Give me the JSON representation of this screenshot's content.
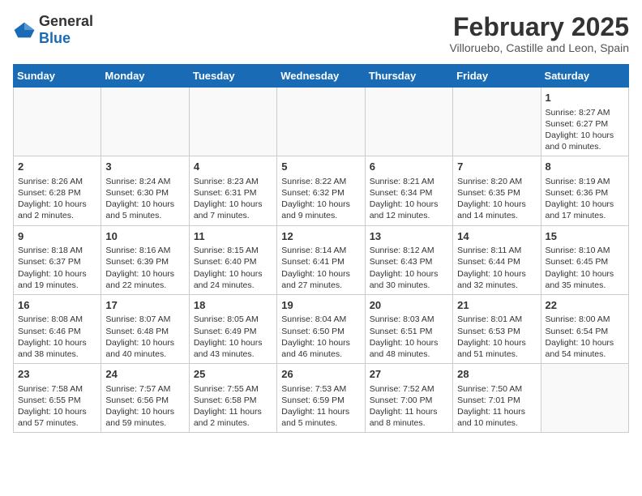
{
  "header": {
    "logo_general": "General",
    "logo_blue": "Blue",
    "title": "February 2025",
    "subtitle": "Villoruebo, Castille and Leon, Spain"
  },
  "days_of_week": [
    "Sunday",
    "Monday",
    "Tuesday",
    "Wednesday",
    "Thursday",
    "Friday",
    "Saturday"
  ],
  "weeks": [
    [
      {
        "day": "",
        "info": ""
      },
      {
        "day": "",
        "info": ""
      },
      {
        "day": "",
        "info": ""
      },
      {
        "day": "",
        "info": ""
      },
      {
        "day": "",
        "info": ""
      },
      {
        "day": "",
        "info": ""
      },
      {
        "day": "1",
        "info": "Sunrise: 8:27 AM\nSunset: 6:27 PM\nDaylight: 10 hours\nand 0 minutes."
      }
    ],
    [
      {
        "day": "2",
        "info": "Sunrise: 8:26 AM\nSunset: 6:28 PM\nDaylight: 10 hours\nand 2 minutes."
      },
      {
        "day": "3",
        "info": "Sunrise: 8:24 AM\nSunset: 6:30 PM\nDaylight: 10 hours\nand 5 minutes."
      },
      {
        "day": "4",
        "info": "Sunrise: 8:23 AM\nSunset: 6:31 PM\nDaylight: 10 hours\nand 7 minutes."
      },
      {
        "day": "5",
        "info": "Sunrise: 8:22 AM\nSunset: 6:32 PM\nDaylight: 10 hours\nand 9 minutes."
      },
      {
        "day": "6",
        "info": "Sunrise: 8:21 AM\nSunset: 6:34 PM\nDaylight: 10 hours\nand 12 minutes."
      },
      {
        "day": "7",
        "info": "Sunrise: 8:20 AM\nSunset: 6:35 PM\nDaylight: 10 hours\nand 14 minutes."
      },
      {
        "day": "8",
        "info": "Sunrise: 8:19 AM\nSunset: 6:36 PM\nDaylight: 10 hours\nand 17 minutes."
      }
    ],
    [
      {
        "day": "9",
        "info": "Sunrise: 8:18 AM\nSunset: 6:37 PM\nDaylight: 10 hours\nand 19 minutes."
      },
      {
        "day": "10",
        "info": "Sunrise: 8:16 AM\nSunset: 6:39 PM\nDaylight: 10 hours\nand 22 minutes."
      },
      {
        "day": "11",
        "info": "Sunrise: 8:15 AM\nSunset: 6:40 PM\nDaylight: 10 hours\nand 24 minutes."
      },
      {
        "day": "12",
        "info": "Sunrise: 8:14 AM\nSunset: 6:41 PM\nDaylight: 10 hours\nand 27 minutes."
      },
      {
        "day": "13",
        "info": "Sunrise: 8:12 AM\nSunset: 6:43 PM\nDaylight: 10 hours\nand 30 minutes."
      },
      {
        "day": "14",
        "info": "Sunrise: 8:11 AM\nSunset: 6:44 PM\nDaylight: 10 hours\nand 32 minutes."
      },
      {
        "day": "15",
        "info": "Sunrise: 8:10 AM\nSunset: 6:45 PM\nDaylight: 10 hours\nand 35 minutes."
      }
    ],
    [
      {
        "day": "16",
        "info": "Sunrise: 8:08 AM\nSunset: 6:46 PM\nDaylight: 10 hours\nand 38 minutes."
      },
      {
        "day": "17",
        "info": "Sunrise: 8:07 AM\nSunset: 6:48 PM\nDaylight: 10 hours\nand 40 minutes."
      },
      {
        "day": "18",
        "info": "Sunrise: 8:05 AM\nSunset: 6:49 PM\nDaylight: 10 hours\nand 43 minutes."
      },
      {
        "day": "19",
        "info": "Sunrise: 8:04 AM\nSunset: 6:50 PM\nDaylight: 10 hours\nand 46 minutes."
      },
      {
        "day": "20",
        "info": "Sunrise: 8:03 AM\nSunset: 6:51 PM\nDaylight: 10 hours\nand 48 minutes."
      },
      {
        "day": "21",
        "info": "Sunrise: 8:01 AM\nSunset: 6:53 PM\nDaylight: 10 hours\nand 51 minutes."
      },
      {
        "day": "22",
        "info": "Sunrise: 8:00 AM\nSunset: 6:54 PM\nDaylight: 10 hours\nand 54 minutes."
      }
    ],
    [
      {
        "day": "23",
        "info": "Sunrise: 7:58 AM\nSunset: 6:55 PM\nDaylight: 10 hours\nand 57 minutes."
      },
      {
        "day": "24",
        "info": "Sunrise: 7:57 AM\nSunset: 6:56 PM\nDaylight: 10 hours\nand 59 minutes."
      },
      {
        "day": "25",
        "info": "Sunrise: 7:55 AM\nSunset: 6:58 PM\nDaylight: 11 hours\nand 2 minutes."
      },
      {
        "day": "26",
        "info": "Sunrise: 7:53 AM\nSunset: 6:59 PM\nDaylight: 11 hours\nand 5 minutes."
      },
      {
        "day": "27",
        "info": "Sunrise: 7:52 AM\nSunset: 7:00 PM\nDaylight: 11 hours\nand 8 minutes."
      },
      {
        "day": "28",
        "info": "Sunrise: 7:50 AM\nSunset: 7:01 PM\nDaylight: 11 hours\nand 10 minutes."
      },
      {
        "day": "",
        "info": ""
      }
    ]
  ]
}
